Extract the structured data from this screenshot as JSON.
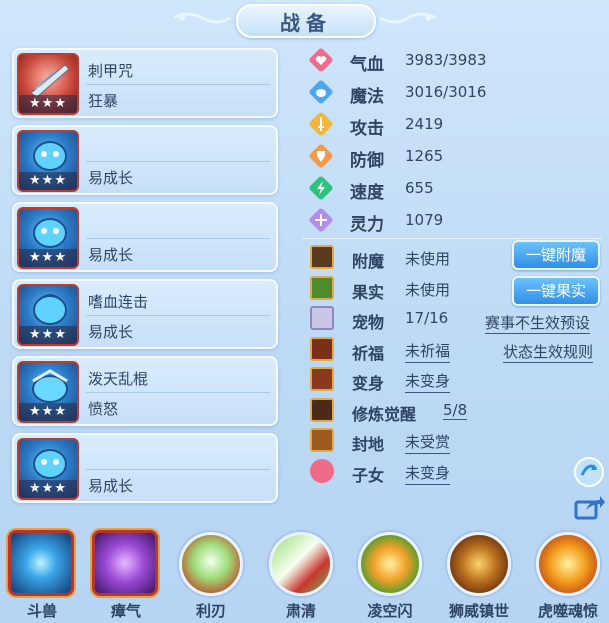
{
  "header": {
    "title": "战备"
  },
  "pets": [
    {
      "line1": "刺甲咒",
      "line2": "狂暴",
      "stars": "★★★",
      "avatar": "weapon-icon"
    },
    {
      "line1": "",
      "line2": "易成长",
      "stars": "★★★",
      "avatar": "pet-icon"
    },
    {
      "line1": "",
      "line2": "易成长",
      "stars": "★★★",
      "avatar": "pet-icon"
    },
    {
      "line1": "嗜血连击",
      "line2": "易成长",
      "stars": "★★★",
      "avatar": "pet-icon"
    },
    {
      "line1": "泼天乱棍",
      "line2": "愤怒",
      "stars": "★★★",
      "avatar": "pet-icon"
    },
    {
      "line1": "",
      "line2": "易成长",
      "stars": "★★★",
      "avatar": "pet-icon"
    }
  ],
  "stats": [
    {
      "label": "气血",
      "value": "3983/3983",
      "icon": "heart-icon",
      "color": "#f06a8a"
    },
    {
      "label": "魔法",
      "value": "3016/3016",
      "icon": "mana-icon",
      "color": "#4ea8f0"
    },
    {
      "label": "攻击",
      "value": "2419",
      "icon": "sword-icon",
      "color": "#f2b73a"
    },
    {
      "label": "防御",
      "value": "1265",
      "icon": "shield-icon",
      "color": "#f29a4a"
    },
    {
      "label": "速度",
      "value": "655",
      "icon": "lightning-icon",
      "color": "#2fc27d"
    },
    {
      "label": "灵力",
      "value": "1079",
      "icon": "spirit-icon",
      "color": "#b38cf0"
    }
  ],
  "status": [
    {
      "label": "附魔",
      "value": "未使用"
    },
    {
      "label": "果实",
      "value": "未使用"
    },
    {
      "label": "宠物",
      "value": "17/16"
    },
    {
      "label": "祈福",
      "value": "未祈福"
    },
    {
      "label": "变身",
      "value": "未变身"
    },
    {
      "label": "修炼觉醒",
      "value": "5/8"
    },
    {
      "label": "封地",
      "value": "未受赏"
    },
    {
      "label": "子女",
      "value": "未变身"
    }
  ],
  "buttons": {
    "enchant": "一键附魔",
    "fruit": "一键果实"
  },
  "links": {
    "preset": "赛事不生效预设",
    "rules": "状态生效规则"
  },
  "skills": [
    {
      "name": "斗兽",
      "icon": "beast-skill-icon"
    },
    {
      "name": "瘴气",
      "icon": "miasma-skill-icon"
    },
    {
      "name": "利刃",
      "icon": "blade-skill-icon"
    },
    {
      "name": "肃清",
      "icon": "purge-skill-icon"
    },
    {
      "name": "凌空闪",
      "icon": "dash-skill-icon"
    },
    {
      "name": "狮威镇世",
      "icon": "lion-skill-icon"
    },
    {
      "name": "虎噬魂惊",
      "icon": "tiger-skill-icon"
    }
  ]
}
